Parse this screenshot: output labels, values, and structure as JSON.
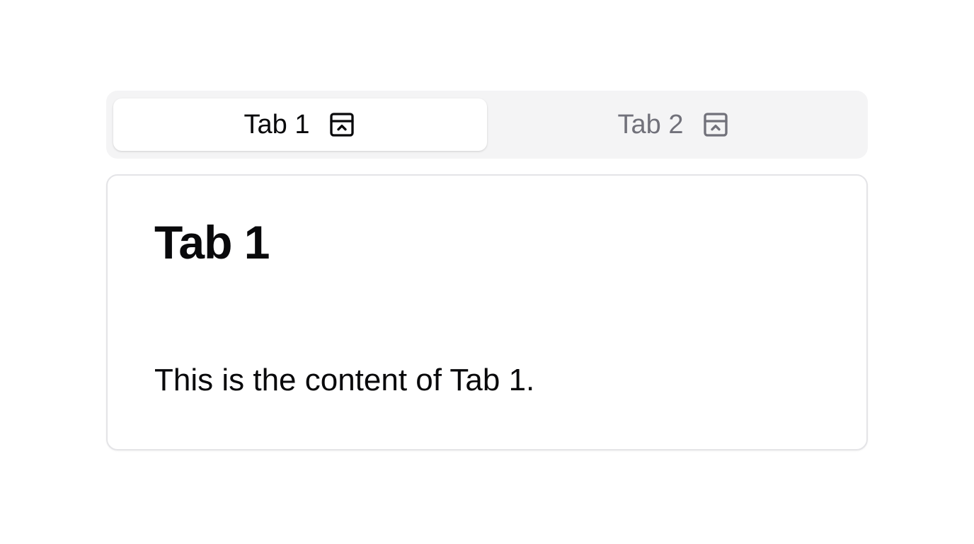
{
  "tabs": [
    {
      "label": "Tab 1",
      "icon": "panel-top-icon",
      "active": true
    },
    {
      "label": "Tab 2",
      "icon": "panel-top-icon",
      "active": false
    }
  ],
  "panel": {
    "title": "Tab 1",
    "content": "This is the content of Tab 1."
  },
  "colors": {
    "active_text": "#09090b",
    "inactive_text": "#71717a",
    "tab_list_bg": "#f4f4f5",
    "border": "#e4e4e7"
  }
}
